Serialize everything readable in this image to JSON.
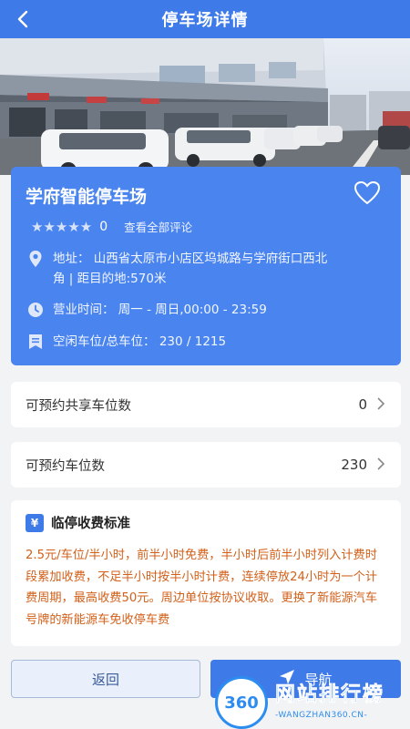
{
  "header": {
    "title": "停车场详情"
  },
  "parking": {
    "name": "学府智能停车场",
    "rating_count": "0",
    "all_reviews": "查看全部评论",
    "address_line1": "地址：  山西省太原市小店区坞城路与学府街口西北",
    "address_line2": "角 | 距目的地:570米",
    "hours": "营业时间：  周一 - 周日,00:00 - 23:59",
    "spaces": "空闲车位/总车位：  230 / 1215"
  },
  "shared_reservable": {
    "label": "可预约共享车位数",
    "value": "0"
  },
  "reservable": {
    "label": "可预约车位数",
    "value": "230"
  },
  "fee": {
    "title": "临停收费标准",
    "badge": "¥",
    "text": "2.5元/车位/半小时，前半小时免费，半小时后前半小时列入计费时段累加收费，不足半小时按半小时计费，连续停放24小时为一个计费周期，最高收费50元。周边单位按协议收取。更换了新能源汽车号牌的新能源车免收停车费"
  },
  "buttons": {
    "back": "返回",
    "navigate": "导航"
  },
  "watermark": {
    "logo": "360",
    "title": "网站排行榜",
    "url": "-WANGZHAN360.CN-"
  },
  "colors": {
    "primary": "#3f7be8",
    "card": "#4a84ef",
    "fee_text": "#d2601a"
  },
  "icons": [
    "back-arrow-icon",
    "heart-icon",
    "star-icon",
    "location-pin-icon",
    "clock-icon",
    "parking-icon",
    "chevron-right-icon",
    "yen-icon",
    "navigate-icon"
  ]
}
